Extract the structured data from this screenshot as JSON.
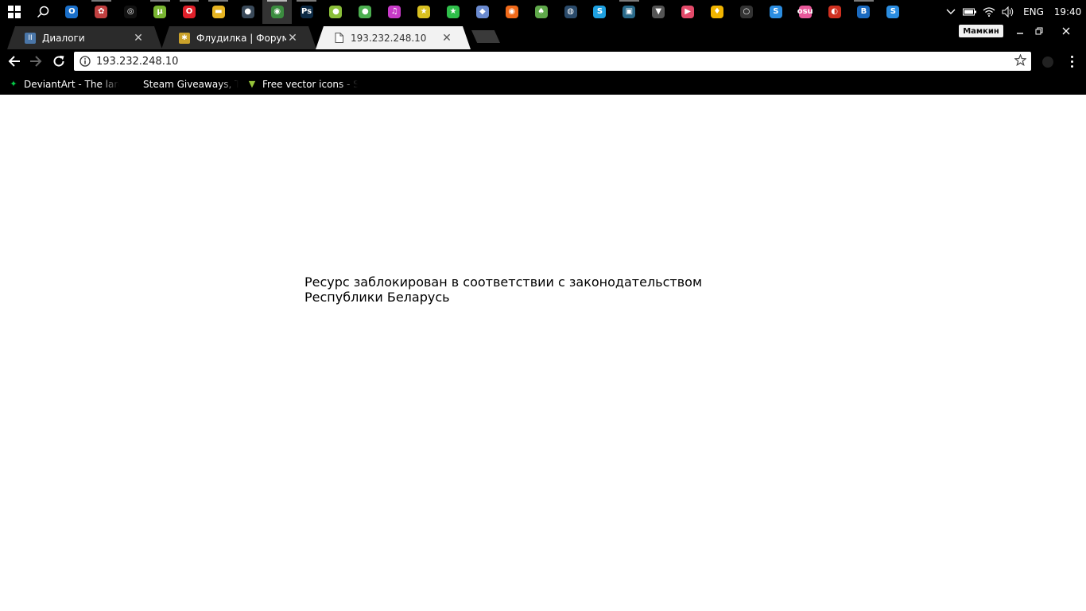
{
  "taskbar": {
    "apps": [
      {
        "icon": "outlook-icon",
        "label": "O",
        "color": "#1a6fc9",
        "running": false
      },
      {
        "icon": "brain-icon",
        "label": "✿",
        "color": "#c04040",
        "running": true
      },
      {
        "icon": "disc-icon",
        "label": "◎",
        "color": "#111111",
        "running": false
      },
      {
        "icon": "utorrent-icon",
        "label": "µ",
        "color": "#79b531",
        "running": true
      },
      {
        "icon": "opera-icon",
        "label": "O",
        "color": "#e0202a",
        "running": true
      },
      {
        "icon": "file-explorer-icon",
        "label": "▬",
        "color": "#e6b422",
        "running": true
      },
      {
        "icon": "cyberghost-icon",
        "label": "●",
        "color": "#3a4a5a",
        "running": false
      },
      {
        "icon": "chrome-icon",
        "label": "◉",
        "color": "#3b8c3f",
        "running": true,
        "active": true
      },
      {
        "icon": "photoshop-icon",
        "label": "Ps",
        "color": "#0c2a45",
        "running": true
      },
      {
        "icon": "globe-app-icon",
        "label": "●",
        "color": "#8bbf3a",
        "running": false
      },
      {
        "icon": "tree-app-icon",
        "label": "●",
        "color": "#4caf50",
        "running": false
      },
      {
        "icon": "itunes-icon",
        "label": "♫",
        "color": "#c83ac8",
        "running": false
      },
      {
        "icon": "star-app-icon",
        "label": "★",
        "color": "#d8c020",
        "running": false
      },
      {
        "icon": "star-green-icon",
        "label": "★",
        "color": "#2fbf4a",
        "running": false
      },
      {
        "icon": "bird-app-icon",
        "label": "◆",
        "color": "#6a8acf",
        "running": false
      },
      {
        "icon": "origin-icon",
        "label": "◉",
        "color": "#f06a1a",
        "running": false
      },
      {
        "icon": "leaf-app-icon",
        "label": "♠",
        "color": "#5fa84a",
        "running": false
      },
      {
        "icon": "steam-icon",
        "label": "◍",
        "color": "#2a4a6a",
        "running": false
      },
      {
        "icon": "skype-icon",
        "label": "S",
        "color": "#1ea0e0",
        "running": false
      },
      {
        "icon": "media-player-icon",
        "label": "▣",
        "color": "#2a6a8a",
        "running": true
      },
      {
        "icon": "android-icon",
        "label": "▼",
        "color": "#555555",
        "running": false
      },
      {
        "icon": "youtube-app-icon",
        "label": "▶",
        "color": "#e34a6a",
        "running": false
      },
      {
        "icon": "fl-studio-icon",
        "label": "♦",
        "color": "#f0b400",
        "running": false
      },
      {
        "icon": "blender-icon",
        "label": "○",
        "color": "#333333",
        "running": false
      },
      {
        "icon": "stylus-app-icon",
        "label": "S",
        "color": "#2b8de0",
        "running": false
      },
      {
        "icon": "osu-icon",
        "label": "osu",
        "color": "#e8589a",
        "running": false
      },
      {
        "icon": "burn-app-icon",
        "label": "◐",
        "color": "#d03020",
        "running": false
      },
      {
        "icon": "ba-app-icon",
        "label": "B",
        "color": "#1a6ac0",
        "running": true
      },
      {
        "icon": "stylus-app-2-icon",
        "label": "S",
        "color": "#2b8de0",
        "running": false
      }
    ],
    "tray": {
      "language": "ENG",
      "clock": "19:40"
    }
  },
  "browser": {
    "tabs": [
      {
        "title": "Диалоги",
        "favicon": "vk-favicon",
        "favicon_label": "II",
        "favicon_color": "#4a76a8",
        "active": false
      },
      {
        "title": "Флудилка | Форум Mipe",
        "favicon": "forum-favicon",
        "favicon_label": "✱",
        "favicon_color": "#caa12a",
        "active": false
      },
      {
        "title": "193.232.248.10",
        "favicon": "page-favicon",
        "favicon_label": "",
        "favicon_color": "#f2f2f2",
        "active": true
      }
    ],
    "profile_name": "Мамкин",
    "address": "193.232.248.10",
    "bookmarks": [
      {
        "label": "DeviantArt - The large",
        "icon": "deviantart-icon",
        "color": "#05cc47",
        "glyph": "✦"
      },
      {
        "label": "Steam Giveaways, Trac",
        "icon": "steam-giveaways-icon",
        "color": "#000000",
        "glyph": ""
      },
      {
        "label": "Free vector icons - SV",
        "icon": "flaticon-icon",
        "color": "#96c53a",
        "glyph": "▼"
      }
    ]
  },
  "page": {
    "message": "Ресурс заблокирован в соответствии с законодательством Республики Беларусь"
  }
}
